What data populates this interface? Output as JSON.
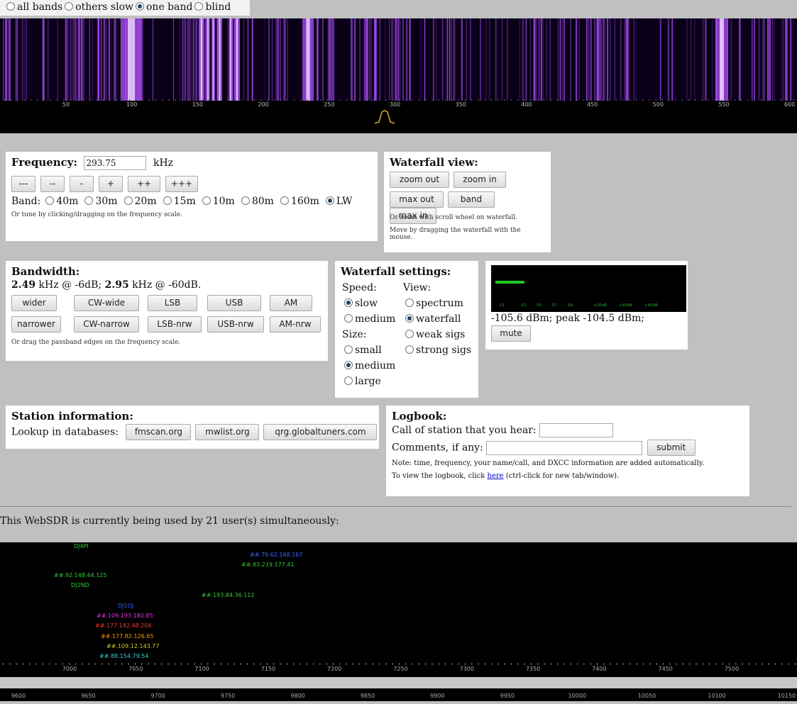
{
  "view_options": [
    {
      "label": "all bands",
      "selected": false
    },
    {
      "label": "others slow",
      "selected": false
    },
    {
      "label": "one band",
      "selected": true
    },
    {
      "label": "blind",
      "selected": false
    }
  ],
  "waterfall": {
    "scale_ticks": [
      "50",
      "100",
      "150",
      "200",
      "250",
      "300",
      "350",
      "400",
      "450",
      "500",
      "550",
      "600"
    ],
    "colors": {
      "background": "#0a0018",
      "signal": "#b050ff",
      "strong": "#f0d8ff",
      "scale_bg": "#000000",
      "tick_text": "#bbbbbb",
      "passband": "#d8b020"
    }
  },
  "frequency": {
    "title": "Frequency:",
    "value": "293.75",
    "unit": "kHz",
    "steps": [
      "---",
      "--",
      "-",
      "+",
      "++",
      "+++"
    ],
    "band_label": "Band:",
    "bands": [
      {
        "label": "40m",
        "selected": false
      },
      {
        "label": "30m",
        "selected": false
      },
      {
        "label": "20m",
        "selected": false
      },
      {
        "label": "15m",
        "selected": false
      },
      {
        "label": "10m",
        "selected": false
      },
      {
        "label": "80m",
        "selected": false
      },
      {
        "label": "160m",
        "selected": false
      },
      {
        "label": "LW",
        "selected": true
      }
    ],
    "hint": "Or tune by clicking/dragging on the frequency scale."
  },
  "waterfall_view": {
    "title": "Waterfall view:",
    "buttons_row1": [
      "zoom out",
      "zoom in"
    ],
    "buttons_row2": [
      "max out",
      "band",
      "max in"
    ],
    "hint1": "Or zoom with scroll wheel on waterfall.",
    "hint2": "Move by dragging the waterfall with the mouse."
  },
  "bandwidth": {
    "title": "Bandwidth:",
    "line_a": "2.49",
    "line_b": " kHz @ -6dB; ",
    "line_c": "2.95",
    "line_d": " kHz @ -60dB.",
    "row1": [
      "wider",
      "CW-wide",
      "LSB",
      "USB",
      "AM"
    ],
    "row2": [
      "narrower",
      "CW-narrow",
      "LSB-nrw",
      "USB-nrw",
      "AM-nrw"
    ],
    "hint": "Or drag the passband edges on the frequency scale."
  },
  "waterfall_settings": {
    "title": "Waterfall settings:",
    "speed_label": "Speed:",
    "speed": [
      {
        "label": "slow",
        "selected": true
      },
      {
        "label": "medium",
        "selected": false
      }
    ],
    "view_label": "View:",
    "view": [
      {
        "label": "spectrum",
        "selected": false
      },
      {
        "label": "waterfall",
        "selected": true
      },
      {
        "label": "weak sigs",
        "selected": false
      },
      {
        "label": "strong sigs",
        "selected": false
      }
    ],
    "size_label": "Size:",
    "size": [
      {
        "label": "small",
        "selected": false
      },
      {
        "label": "medium",
        "selected": true
      },
      {
        "label": "large",
        "selected": false
      }
    ]
  },
  "smeter": {
    "scale": [
      "S1",
      "S3",
      "S5",
      "S7",
      "S9",
      "+20dB",
      "+40dB",
      "+60dB"
    ],
    "level": 0.16,
    "readout": "-105.6 dBm; peak -104.5 dBm;",
    "mute_label": "mute",
    "colors": {
      "bar": "#22cc22",
      "text": "#22aa22"
    }
  },
  "station": {
    "title": "Station information:",
    "lookup_label": "Lookup in databases:",
    "buttons": [
      "fmscan.org",
      "mwlist.org",
      "qrg.globaltuners.com"
    ]
  },
  "logbook": {
    "title": "Logbook:",
    "call_label": "Call of station that you hear:",
    "comments_label": "Comments, if any:",
    "submit_label": "submit",
    "note": "Note: time, frequency, your name/call, and DXCC information are added automatically.",
    "view_prefix": "To view the logbook, click ",
    "view_link": "here",
    "view_suffix": " (ctrl-click for new tab/window)."
  },
  "usage_text": "This WebSDR is currently being used by 21 user(s) simultaneously:",
  "users_band": {
    "users": [
      {
        "label": "DJ4PI",
        "color": "#33cc33"
      },
      {
        "label": "##.79.62.168.167",
        "color": "#3366ff"
      },
      {
        "label": "##.83.219.177.41",
        "color": "#33cc33"
      },
      {
        "label": "##.92.148.44.125",
        "color": "#33cc33"
      },
      {
        "label": "DJ2ND",
        "color": "#33cc33"
      },
      {
        "label": "##.193.84.36.112",
        "color": "#33cc33"
      },
      {
        "label": "DJ1OJ",
        "color": "#3366ff"
      },
      {
        "label": "##.109.193.180.85",
        "color": "#dd33dd"
      },
      {
        "label": "##.177.142.48.204",
        "color": "#ff3333"
      },
      {
        "label": "##.177.82.126.65",
        "color": "#ff9900"
      },
      {
        "label": "##.109.12.143.77",
        "color": "#cccc33"
      },
      {
        "label": "##.88.154.79.54",
        "color": "#33cccc"
      }
    ],
    "scale_upper": [
      "7000",
      "7050",
      "7100",
      "7150",
      "7200",
      "7250",
      "7300",
      "7350",
      "7400",
      "7450",
      "7500"
    ],
    "scale_lower": [
      "9600",
      "9650",
      "9700",
      "9750",
      "9800",
      "9850",
      "9900",
      "9950",
      "10000",
      "10050",
      "10100",
      "10150"
    ],
    "colors": {
      "tick_text": "#aaaaaa",
      "lower_bar": "#c8c8c8"
    }
  }
}
